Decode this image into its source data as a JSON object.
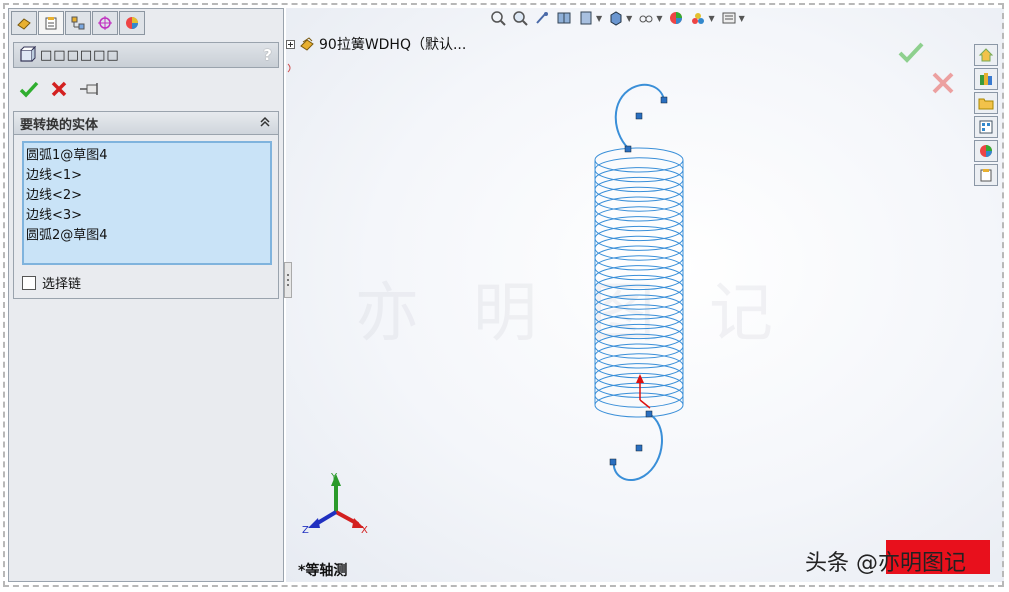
{
  "tabs": [
    {
      "icon": "feature-manager-icon",
      "active": false
    },
    {
      "icon": "property-manager-icon",
      "active": true
    },
    {
      "icon": "configuration-manager-icon",
      "active": false
    },
    {
      "icon": "dim-xpert-icon",
      "active": false
    },
    {
      "icon": "display-manager-icon",
      "active": false
    }
  ],
  "property_manager": {
    "title": "□□□□□□",
    "help_label": "?",
    "ok_icon": "check-icon",
    "cancel_icon": "x-icon",
    "pin_icon": "pushpin-icon"
  },
  "selection_group": {
    "title": "要转换的实体",
    "items": [
      "圆弧1@草图4",
      "边线<1>",
      "边线<2>",
      "边线<3>",
      "圆弧2@草图4"
    ],
    "checkbox_label": "选择链",
    "checkbox_checked": false
  },
  "tree": {
    "label": "90拉簧WDHQ（默认..."
  },
  "view": {
    "orientation_label": "*等轴测"
  },
  "triad": {
    "x": "X",
    "y": "Y",
    "z": "Z"
  },
  "watermark": {
    "text": "头条 @亦明图记",
    "faint_text": "亦明图记"
  },
  "colors": {
    "spring": "#3a8fd8",
    "confirm": "#2fae2f",
    "cancel": "#d32020",
    "listbox_bg": "#c9e3f7",
    "stamp": "#e8101c"
  }
}
